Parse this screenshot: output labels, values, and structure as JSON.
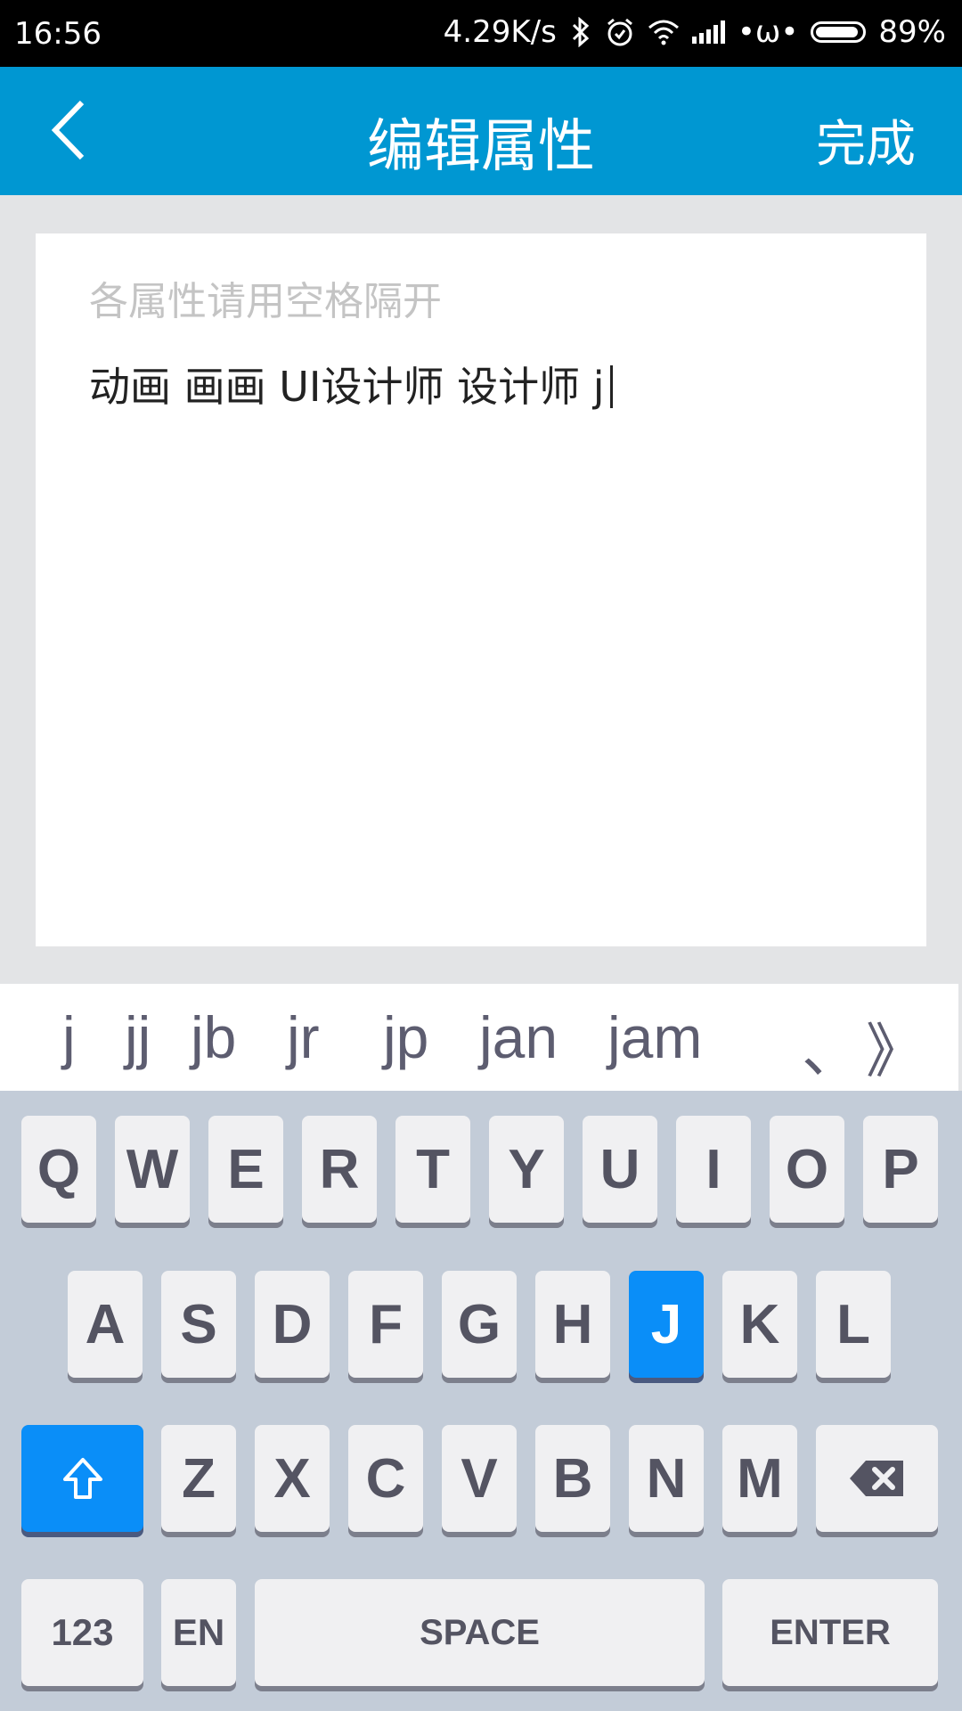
{
  "status_bar": {
    "time": "16:56",
    "network_speed": "4.29K/s",
    "icons": [
      "bluetooth-icon",
      "alarm-icon",
      "wifi-icon",
      "signal-icon"
    ],
    "extra": "•ω•",
    "battery": "89%"
  },
  "app_bar": {
    "back_icon": "chevron-left-icon",
    "title": "编辑属性",
    "done_label": "完成"
  },
  "editor": {
    "placeholder": "各属性请用空格隔开",
    "value": "动画 画画 UI设计师 设计师 j"
  },
  "candidates": [
    "j",
    "jj",
    "jb",
    "jr",
    "jp",
    "jan",
    "jam"
  ],
  "candidate_extra": {
    "separator": "、",
    "more": "》"
  },
  "keyboard": {
    "row1": [
      "Q",
      "W",
      "E",
      "R",
      "T",
      "Y",
      "U",
      "I",
      "O",
      "P"
    ],
    "row2": [
      "A",
      "S",
      "D",
      "F",
      "G",
      "H",
      "J",
      "K",
      "L"
    ],
    "row3": [
      "Z",
      "X",
      "C",
      "V",
      "B",
      "N",
      "M"
    ],
    "shift_icon": "shift-arrow-icon",
    "backspace_icon": "backspace-icon",
    "num_label": "123",
    "lang_label": "EN",
    "space_label": "SPACE",
    "enter_label": "ENTER",
    "active_key": "J",
    "accent_color": "#0a8ef8"
  },
  "colors": {
    "app_bar": "#0097d2",
    "keyboard_bg": "#c3ccd8",
    "placeholder": "#c4c4c4"
  }
}
